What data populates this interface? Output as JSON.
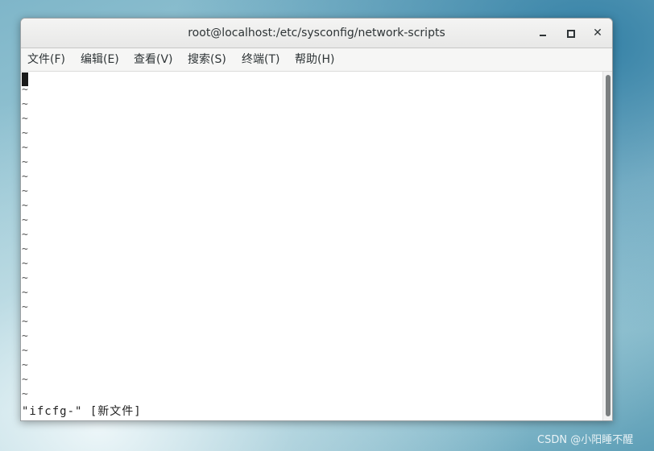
{
  "window": {
    "title": "root@localhost:/etc/sysconfig/network-scripts",
    "controls": {
      "close_label": "✕"
    }
  },
  "menu": {
    "items": [
      {
        "label": "文件(F)"
      },
      {
        "label": "编辑(E)"
      },
      {
        "label": "查看(V)"
      },
      {
        "label": "搜索(S)"
      },
      {
        "label": "终端(T)"
      },
      {
        "label": "帮助(H)"
      }
    ]
  },
  "terminal": {
    "empty_line_marker": "~",
    "status_line": "\"ifcfg-\" [新文件]"
  },
  "watermark": "CSDN @小阳睡不醒"
}
